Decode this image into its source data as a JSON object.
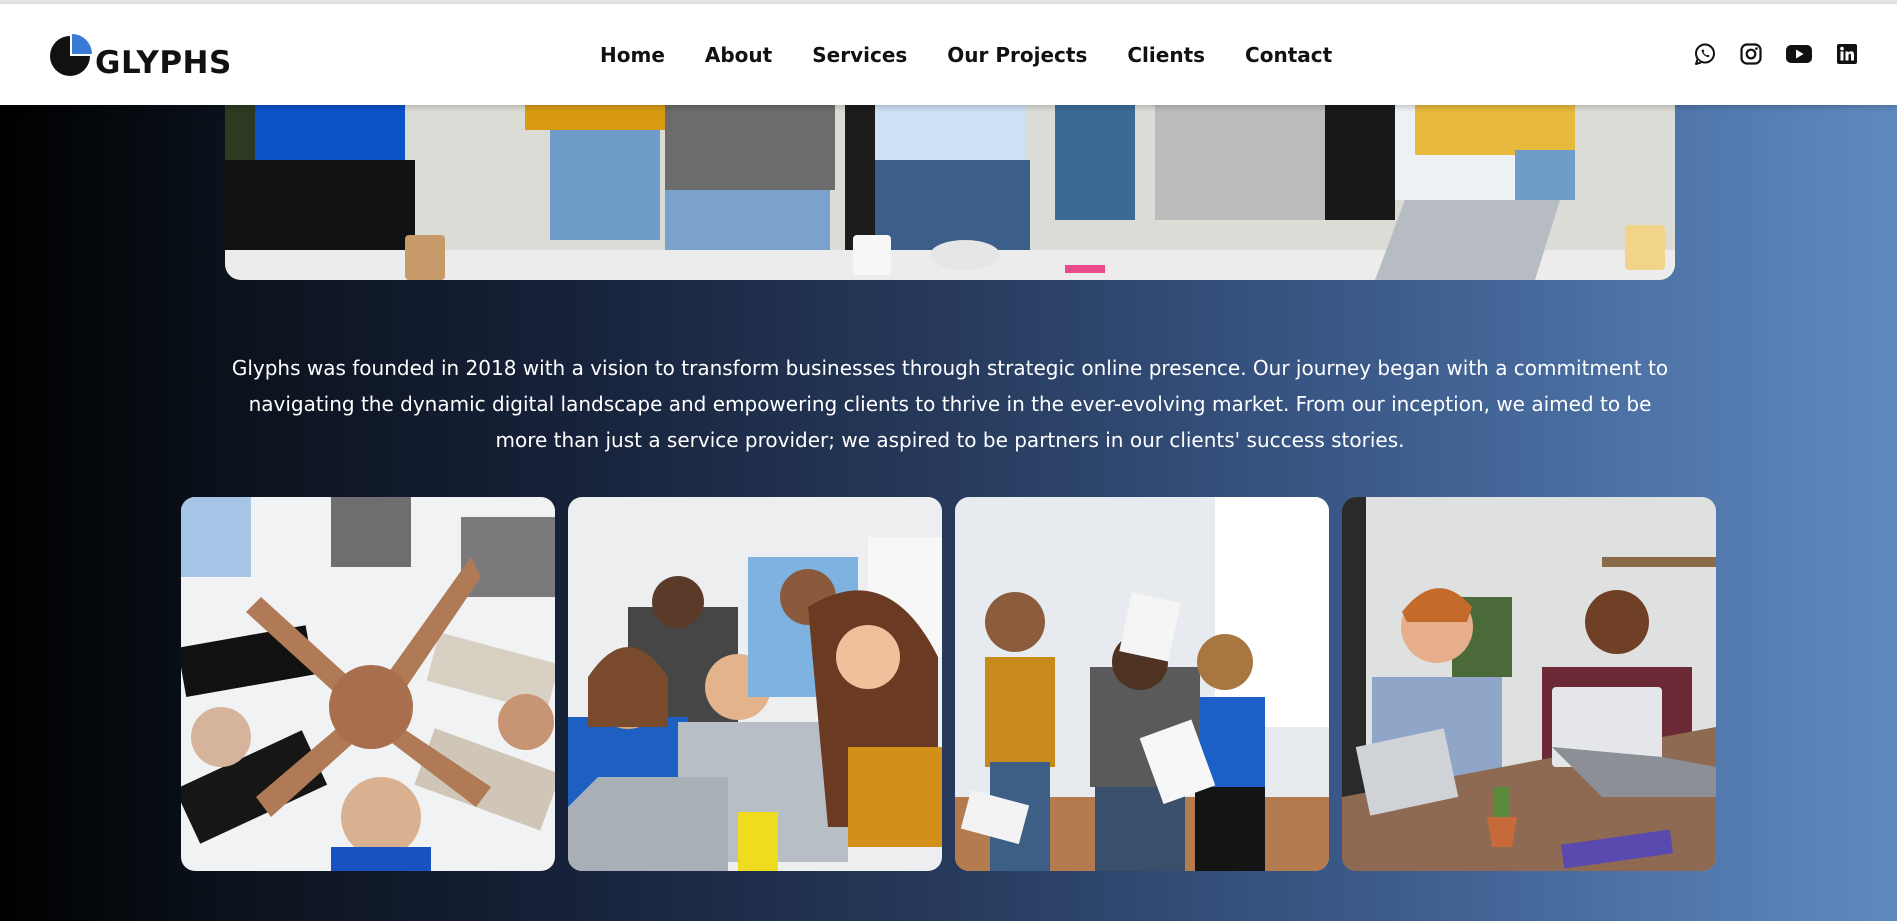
{
  "brand": {
    "name": "GLYPHS",
    "logo_icon": "glyphs-logo-mark"
  },
  "nav": {
    "items": [
      {
        "label": "Home"
      },
      {
        "label": "About"
      },
      {
        "label": "Services"
      },
      {
        "label": "Our Projects"
      },
      {
        "label": "Clients"
      },
      {
        "label": "Contact"
      }
    ]
  },
  "social": [
    {
      "icon": "whatsapp-icon"
    },
    {
      "icon": "instagram-icon"
    },
    {
      "icon": "youtube-icon"
    },
    {
      "icon": "linkedin-icon"
    }
  ],
  "about": {
    "paragraph": "Glyphs was founded in 2018 with a vision to transform businesses through strategic online presence. Our journey began with a commitment to navigating the dynamic digital landscape and empowering clients to thrive in the ever-evolving market. From our inception, we aimed to be more than just a service provider; we aspired to be partners in our clients' success stories."
  },
  "colors": {
    "background_start": "#000000",
    "background_end": "#5f8ac0",
    "header_bg": "#ffffff",
    "logo_blue": "#3a7bd5",
    "text_light": "#ffffff",
    "text_dark": "#111111"
  }
}
